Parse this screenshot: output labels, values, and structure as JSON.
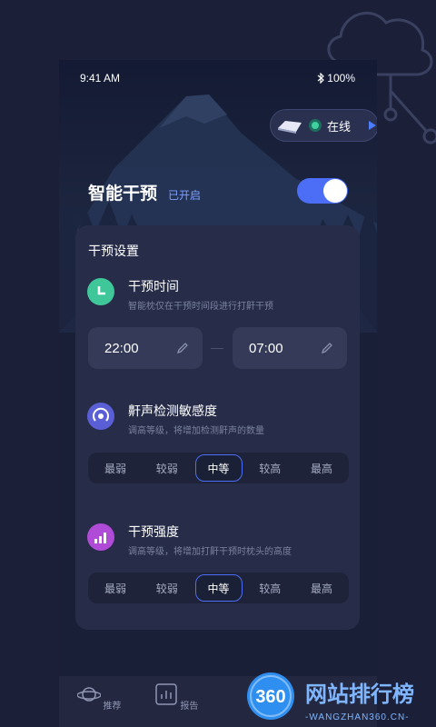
{
  "status": {
    "time": "9:41 AM",
    "battery": "100%",
    "bluetooth_icon": "bluetooth-icon"
  },
  "device": {
    "online_label": "在线"
  },
  "header": {
    "title": "智能干预",
    "state": "已开启",
    "toggle_on": true
  },
  "settings": {
    "title": "干预设置",
    "schedule": {
      "title": "干预时间",
      "desc": "智能枕仅在干预时间段进行打鼾干预",
      "start": "22:00",
      "end": "07:00"
    },
    "sensitivity": {
      "title": "鼾声检测敏感度",
      "desc": "调高等级，将增加检测鼾声的数量",
      "options": [
        "最弱",
        "较弱",
        "中等",
        "较高",
        "最高"
      ],
      "selected": "中等"
    },
    "intensity": {
      "title": "干预强度",
      "desc": "调高等级，将增加打鼾干预时枕头的高度",
      "options": [
        "最弱",
        "较弱",
        "中等",
        "较高",
        "最高"
      ],
      "selected": "中等"
    }
  },
  "tabs": [
    {
      "label": "推荐"
    },
    {
      "label": "报告"
    }
  ],
  "watermark": {
    "brand": "网站排行榜",
    "number": "360",
    "site": "-WANGZHAN360.CN-"
  },
  "colors": {
    "accent": "#4c6df5",
    "online": "#3fd0a0",
    "background": "#1b2038"
  }
}
